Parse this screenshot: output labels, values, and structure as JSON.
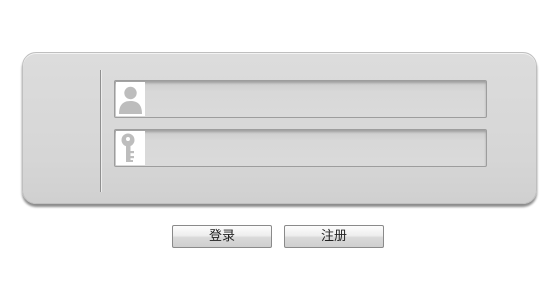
{
  "form": {
    "username": {
      "icon": "user-silhouette-icon",
      "value": "",
      "placeholder": ""
    },
    "password": {
      "icon": "key-icon",
      "value": "",
      "placeholder": ""
    }
  },
  "buttons": {
    "login_label": "登录",
    "register_label": "注册"
  },
  "colors": {
    "panel": "#d6d6d6",
    "field": "#d8d8d8",
    "icon_background": "#ffffff",
    "icon_fill": "#bdbdbd"
  }
}
